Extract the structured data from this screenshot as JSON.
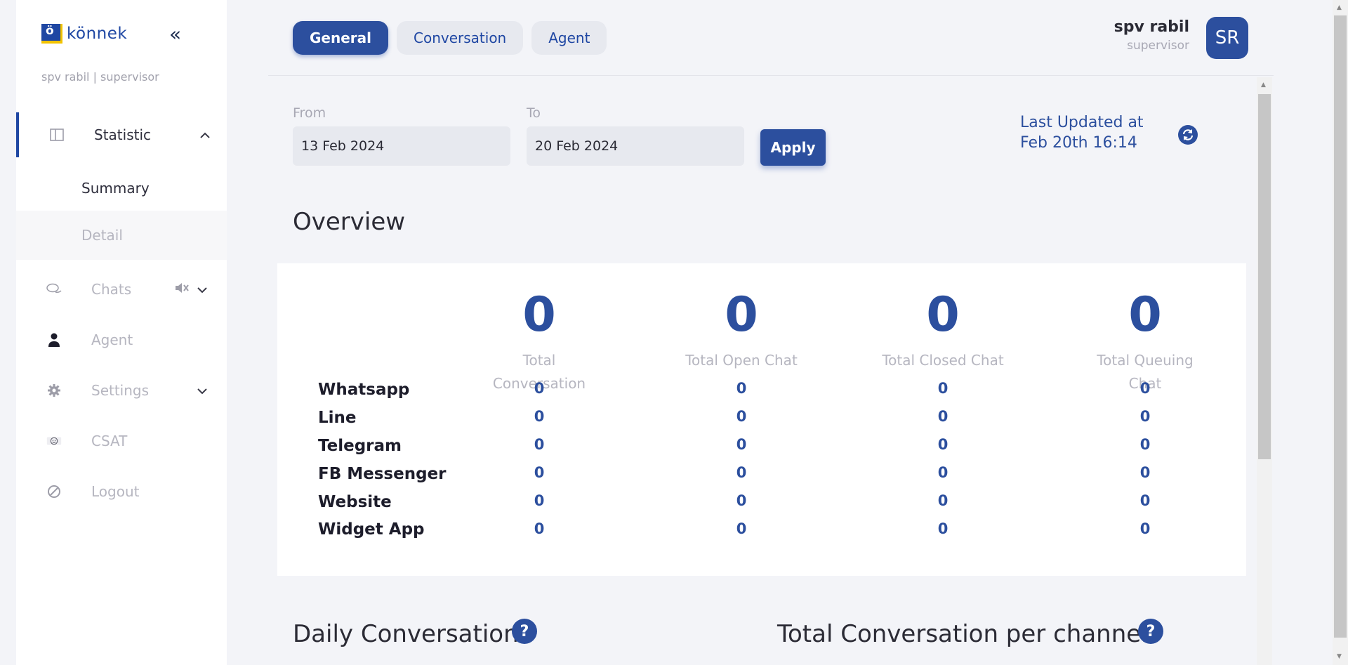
{
  "sidebar": {
    "logo_letter": "ö",
    "logo_text": "könnek",
    "collapse_glyph": "«",
    "user_line": "spv rabil | supervisor",
    "items": {
      "statistic": "Statistic",
      "summary": "Summary",
      "detail": "Detail",
      "chats": "Chats",
      "agent": "Agent",
      "settings": "Settings",
      "csat": "CSAT",
      "logout": "Logout"
    },
    "icons": [
      "columns-icon",
      "chat-bubbles-icon",
      "person-icon",
      "gear-icon",
      "smiley-icon",
      "logout-icon",
      "mute-icon"
    ]
  },
  "header": {
    "tabs": [
      "General",
      "Conversation",
      "Agent"
    ],
    "active_tab": "General",
    "user_name": "spv rabil",
    "user_role": "supervisor",
    "avatar_initials": "SR"
  },
  "filters": {
    "from_label": "From",
    "from_value": "13 Feb 2024",
    "to_label": "To",
    "to_value": "20 Feb 2024",
    "apply_label": "Apply",
    "last_updated_line1": "Last Updated at",
    "last_updated_line2": "Feb 20th 16:14"
  },
  "overview": {
    "title": "Overview",
    "stats": [
      {
        "value": "0",
        "label": "Total Conversation"
      },
      {
        "value": "0",
        "label": "Total Open Chat"
      },
      {
        "value": "0",
        "label": "Total Closed Chat"
      },
      {
        "value": "0",
        "label": "Total Queuing Chat"
      }
    ],
    "rows": [
      {
        "channel": "Whatsapp",
        "values": [
          "0",
          "0",
          "0",
          "0"
        ]
      },
      {
        "channel": "Line",
        "values": [
          "0",
          "0",
          "0",
          "0"
        ]
      },
      {
        "channel": "Telegram",
        "values": [
          "0",
          "0",
          "0",
          "0"
        ]
      },
      {
        "channel": "FB Messenger",
        "values": [
          "0",
          "0",
          "0",
          "0"
        ]
      },
      {
        "channel": "Website",
        "values": [
          "0",
          "0",
          "0",
          "0"
        ]
      },
      {
        "channel": "Widget App",
        "values": [
          "0",
          "0",
          "0",
          "0"
        ]
      }
    ]
  },
  "sections": {
    "daily_title": "Daily Conversation",
    "per_channel_title": "Total Conversation per channel",
    "help_glyph": "?"
  },
  "colors": {
    "primary": "#2c4f9e",
    "accent_yellow": "#f2c300",
    "muted_text": "#b6b6c0"
  }
}
